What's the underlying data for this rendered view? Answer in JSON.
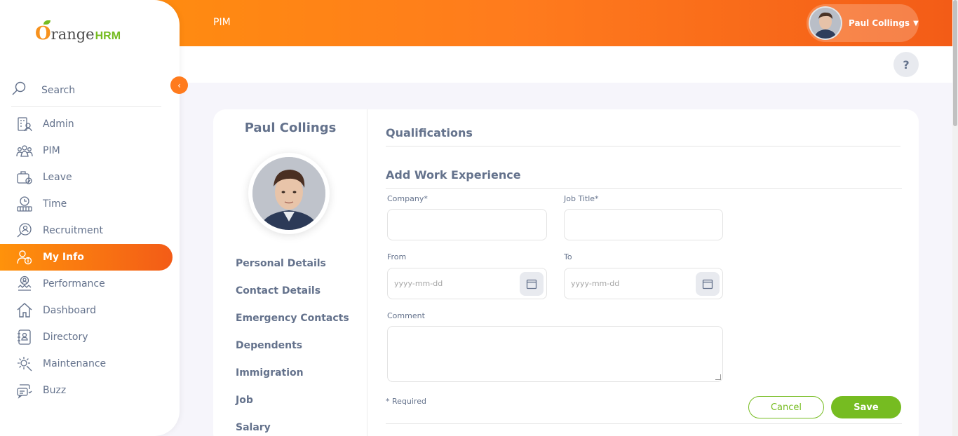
{
  "header": {
    "module": "PIM",
    "user_name": "Paul Collings",
    "help": "?"
  },
  "brand": {
    "o": "O",
    "range": "range",
    "hrm": "HRM"
  },
  "sidebar": {
    "search_label": "Search",
    "items": [
      {
        "label": "Admin",
        "icon": "admin-icon"
      },
      {
        "label": "PIM",
        "icon": "pim-icon"
      },
      {
        "label": "Leave",
        "icon": "leave-icon"
      },
      {
        "label": "Time",
        "icon": "time-icon"
      },
      {
        "label": "Recruitment",
        "icon": "recruitment-icon"
      },
      {
        "label": "My Info",
        "icon": "my-info-icon",
        "active": true
      },
      {
        "label": "Performance",
        "icon": "performance-icon"
      },
      {
        "label": "Dashboard",
        "icon": "dashboard-icon"
      },
      {
        "label": "Directory",
        "icon": "directory-icon"
      },
      {
        "label": "Maintenance",
        "icon": "maintenance-icon"
      },
      {
        "label": "Buzz",
        "icon": "buzz-icon"
      }
    ]
  },
  "employee": {
    "name": "Paul Collings",
    "tabs": [
      "Personal Details",
      "Contact Details",
      "Emergency Contacts",
      "Dependents",
      "Immigration",
      "Job",
      "Salary"
    ]
  },
  "main": {
    "section_title": "Qualifications",
    "form_title": "Add Work Experience",
    "company_label": "Company*",
    "company_value": "",
    "job_title_label": "Job Title*",
    "job_title_value": "",
    "from_label": "From",
    "from_placeholder": "yyyy-mm-dd",
    "to_label": "To",
    "to_placeholder": "yyyy-mm-dd",
    "comment_label": "Comment",
    "required_note": "* Required",
    "cancel_label": "Cancel",
    "save_label": "Save"
  },
  "colors": {
    "accent": "#ff7b1d",
    "green": "#76bc21",
    "text": "#64728c"
  }
}
